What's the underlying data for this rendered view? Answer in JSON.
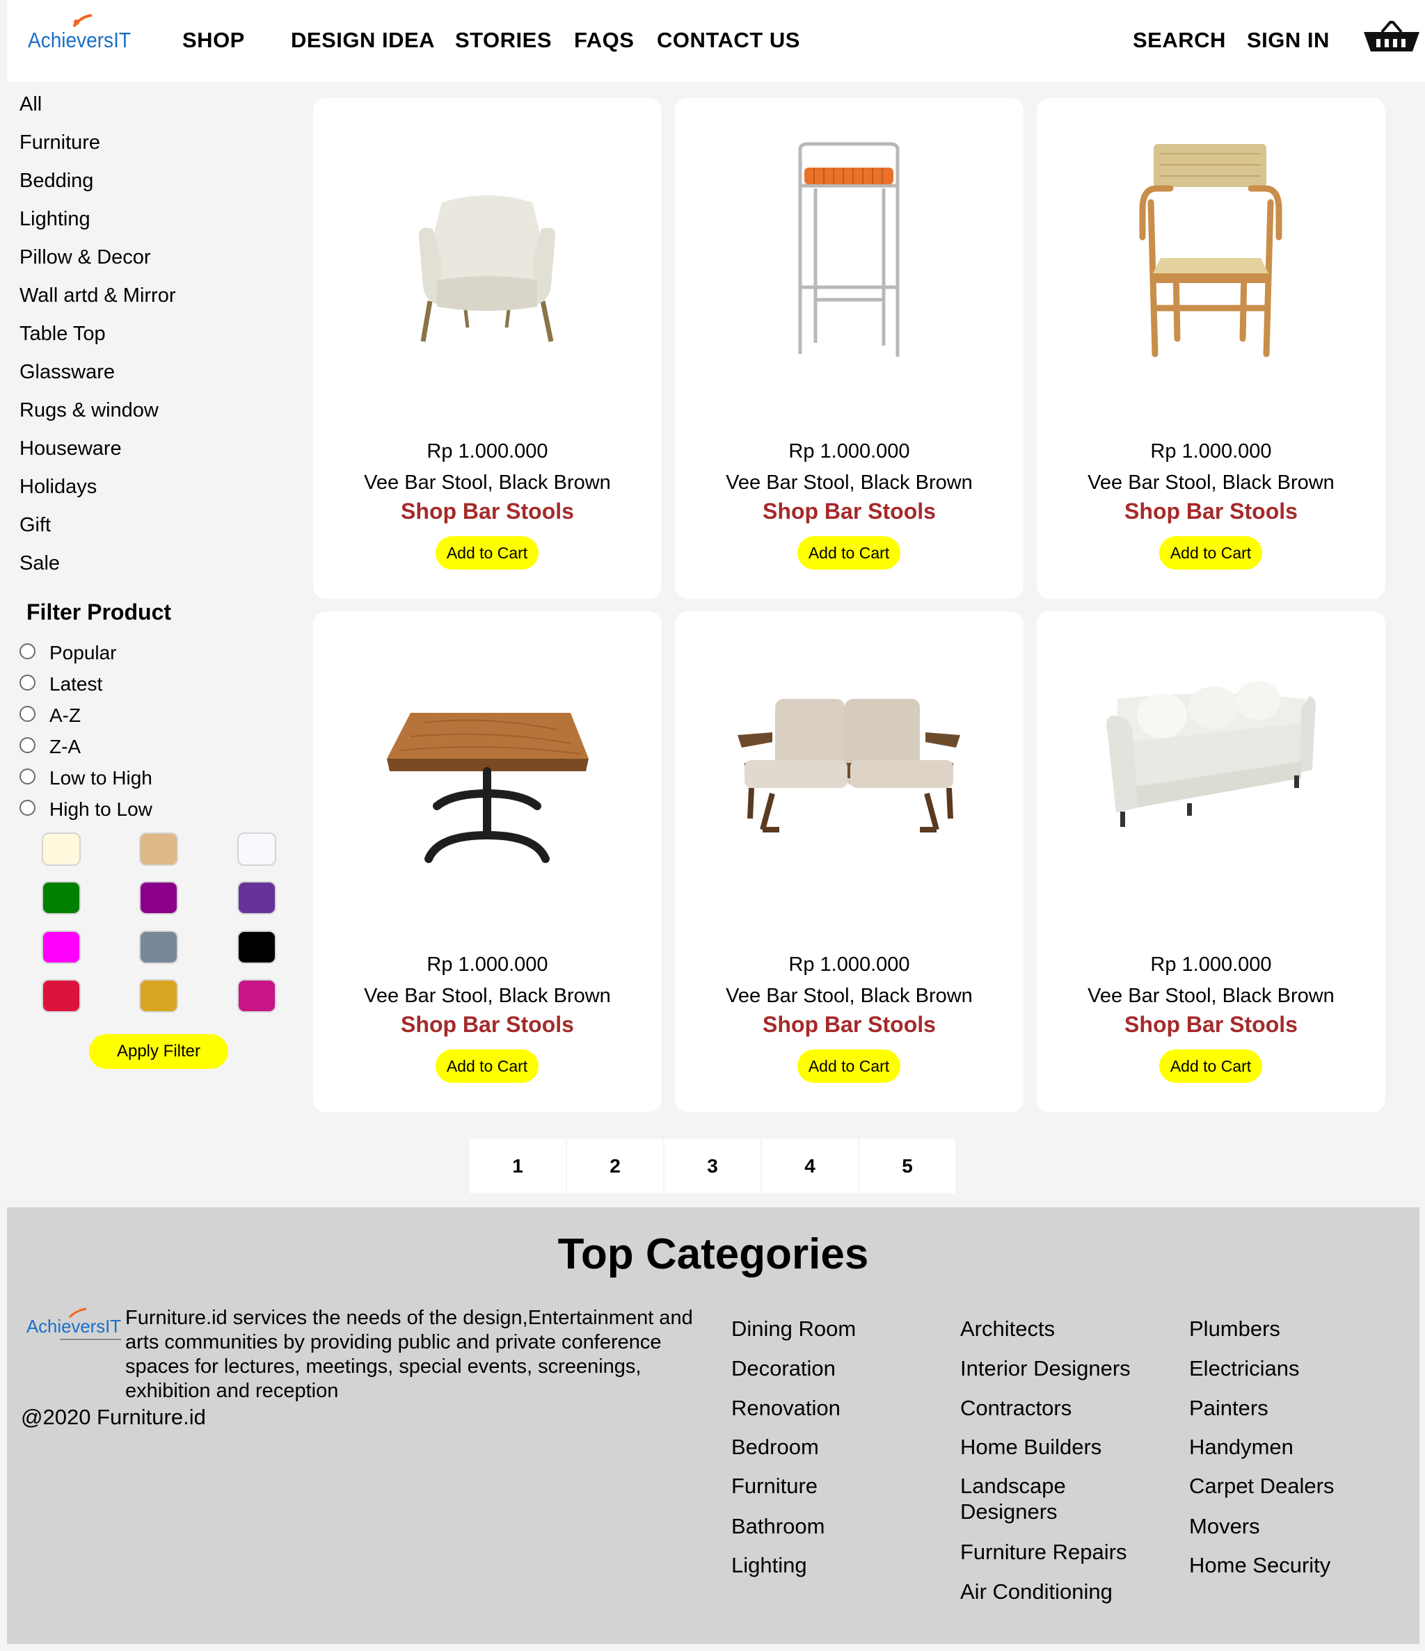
{
  "header": {
    "logo_text": "AchieversIT",
    "nav": [
      "SHOP",
      "DESIGN IDEA",
      "STORIES",
      "FAQS",
      "CONTACT US"
    ],
    "right": [
      "SEARCH",
      "SIGN IN"
    ],
    "cart_icon": "shopping-basket-icon"
  },
  "sidebar": {
    "categories": [
      "All",
      "Furniture",
      "Bedding",
      "Lighting",
      "Pillow & Decor",
      "Wall artd & Mirror",
      "Table Top",
      "Glassware",
      "Rugs & window",
      "Houseware",
      "Holidays",
      "Gift",
      "Sale"
    ],
    "filter_title": "Filter Product",
    "sort_options": [
      "Popular",
      "Latest",
      "A-Z",
      "Z-A",
      "Low to High",
      "High to Low"
    ],
    "color_swatches": [
      "#fff8dc",
      "#deb887",
      "#f8f8ff",
      "#008000",
      "#8b008b",
      "#663399",
      "#ff00ff",
      "#778899",
      "#000000",
      "#dc143c",
      "#daa520",
      "#c71585"
    ],
    "apply_label": "Apply Filter"
  },
  "products": [
    {
      "image": "armchair",
      "price": "Rp 1.000.000",
      "name": "Vee Bar Stool, Black Brown",
      "link": "Shop Bar Stools",
      "button": "Add to Cart"
    },
    {
      "image": "bar-stool",
      "price": "Rp 1.000.000",
      "name": "Vee Bar Stool, Black Brown",
      "link": "Shop Bar Stools",
      "button": "Add to Cart"
    },
    {
      "image": "wooden-chair",
      "price": "Rp 1.000.000",
      "name": "Vee Bar Stool, Black Brown",
      "link": "Shop Bar Stools",
      "button": "Add to Cart"
    },
    {
      "image": "wood-table",
      "price": "Rp 1.000.000",
      "name": "Vee Bar Stool, Black Brown",
      "link": "Shop Bar Stools",
      "button": "Add to Cart"
    },
    {
      "image": "loveseat",
      "price": "Rp 1.000.000",
      "name": "Vee Bar Stool, Black Brown",
      "link": "Shop Bar Stools",
      "button": "Add to Cart"
    },
    {
      "image": "white-sofa",
      "price": "Rp 1.000.000",
      "name": "Vee Bar Stool, Black Brown",
      "link": "Shop Bar Stools",
      "button": "Add to Cart"
    }
  ],
  "pagination": [
    "1",
    "2",
    "3",
    "4",
    "5"
  ],
  "footer": {
    "title": "Top Categories",
    "logo_text": "AchieversIT",
    "description": "Furniture.id services the needs of the design,Entertainment and arts communities by providing public and private conference spaces for lectures, meetings, special events, screenings, exhibition and reception",
    "copyright": "@2020 Furniture.id",
    "col1": [
      "Dining Room",
      "Decoration",
      "Renovation",
      "Bedroom",
      "Furniture",
      "Bathroom",
      "Lighting"
    ],
    "col2": [
      "Architects",
      "Interior Designers",
      "Contractors",
      "Home Builders",
      "Landscape Designers",
      "Furniture Repairs",
      "Air Conditioning"
    ],
    "col3": [
      "Plumbers",
      "Electricians",
      "Painters",
      "Handymen",
      "Carpet Dealers",
      "Movers",
      "Home Security"
    ]
  },
  "colors": {
    "button": "#ffff00",
    "link": "#a52a2a",
    "footer_bg": "#d3d3d3",
    "page_bg": "#f4f4f4"
  }
}
